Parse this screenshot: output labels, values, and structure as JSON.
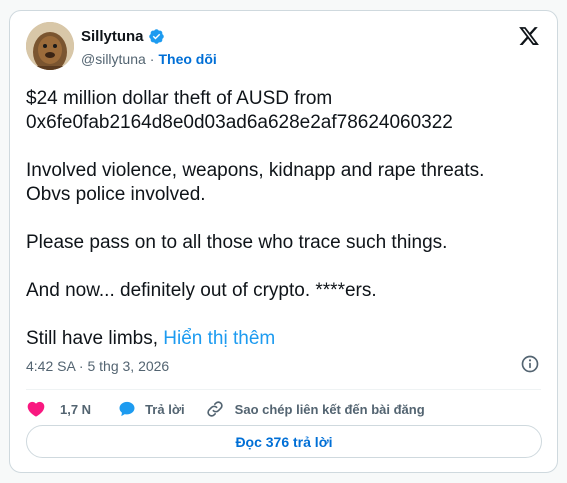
{
  "author": {
    "display_name": "Sillytuna",
    "handle": "@sillytuna",
    "separator": "·",
    "follow_label": "Theo dõi",
    "verified_color": "#1d9bf0"
  },
  "platform_logo": "x-logo-icon",
  "tweet": {
    "line1": "$24 million dollar theft of AUSD from",
    "line2": "0x6fe0fab2164d8e0d03ad6a628e2af78624060322",
    "para2_line1": "Involved violence, weapons, kidnapp and rape threats.",
    "para2_line2": "Obvs police involved.",
    "para3": "Please pass on to all those who trace such things.",
    "para4": "And now... definitely out of crypto. ****ers.",
    "para5_prefix": "Still have limbs, ",
    "show_more": "Hiển thị thêm"
  },
  "timestamp": "4:42 SA · 5 thg 3, 2026",
  "actions": {
    "likes": "1,7 N",
    "reply": "Trả lời",
    "copy_link": "Sao chép liên kết đến bài đăng"
  },
  "read_replies": "Đọc 376 trả lời",
  "colors": {
    "like": "#f91880",
    "reply": "#1d9bf0",
    "link": "#006fd6",
    "muted": "#536471"
  }
}
